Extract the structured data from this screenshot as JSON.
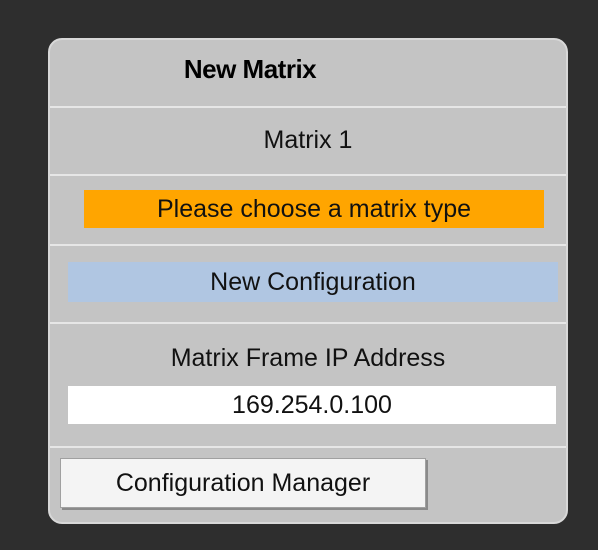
{
  "panel": {
    "title": "New Matrix",
    "matrix_name": "Matrix 1",
    "warning": "Please choose a matrix type",
    "new_configuration": "New Configuration",
    "ip_label": "Matrix Frame IP Address",
    "ip_value": "169.254.0.100",
    "config_manager_label": "Configuration Manager"
  },
  "colors": {
    "background_frame": "#2e2e2e",
    "panel": "#c4c4c4",
    "warning": "#ffa500",
    "new_configuration": "#b0c6e2",
    "input": "#ffffff"
  }
}
